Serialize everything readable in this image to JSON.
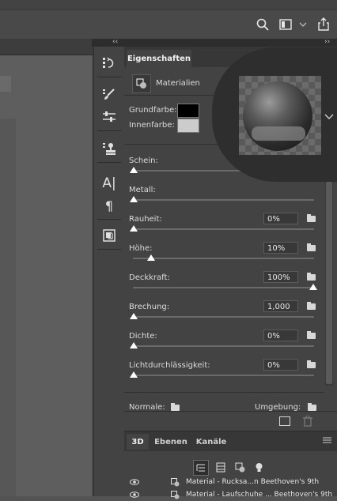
{
  "optionsbar": {
    "icons": [
      "search-icon",
      "workspace-icon",
      "chevron-down-icon",
      "share-icon"
    ]
  },
  "dock": {
    "collapse_left": "‹‹",
    "collapse_right": "››"
  },
  "iconcolumn": {
    "icons": [
      "history-icon",
      "brush-icon",
      "adjustments-icon",
      "clone-source-icon",
      "character-icon",
      "paragraph-icon",
      "glyphs-icon"
    ],
    "character_glyph": "A|",
    "paragraph_glyph": "¶"
  },
  "properties": {
    "tab": "Eigenschaften",
    "type_label": "Materialien",
    "grundfarbe_label": "Grundfarbe:",
    "innenfarbe_label": "Innenfarbe:",
    "grundfarbe_color": "#000000",
    "innenfarbe_color": "#cccccc",
    "sliders": [
      {
        "label": "Schein:",
        "value": "",
        "level": 0
      },
      {
        "label": "Metall:",
        "value": "",
        "level": 0
      },
      {
        "label": "Rauheit:",
        "value": "0%",
        "level": 0
      },
      {
        "label": "Höhe:",
        "value": "10%",
        "level": 0.1
      },
      {
        "label": "Deckkraft:",
        "value": "100%",
        "level": 1
      },
      {
        "label": "Brechung:",
        "value": "1,000",
        "level": 0
      },
      {
        "label": "Dichte:",
        "value": "0%",
        "level": 0
      },
      {
        "label": "Lichtdurchlässigkeit:",
        "value": "0%",
        "level": 0
      }
    ],
    "normals_label": "Normale:",
    "umgebung_label": "Umgebung:"
  },
  "panel3d": {
    "tabs": [
      "3D",
      "Ebenen",
      "Kanäle"
    ],
    "active_tab": "3D",
    "rows": [
      {
        "label": "Material - Rucksa...n Beethoven's 9th"
      },
      {
        "label": "Material - Laufschuhe ... Beethoven's 9th"
      }
    ]
  }
}
